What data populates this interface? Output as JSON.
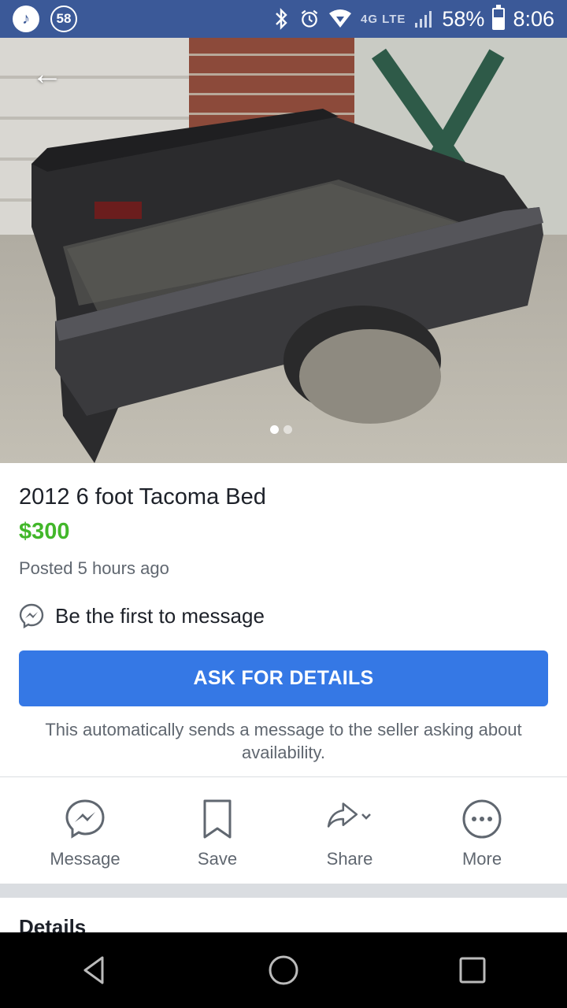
{
  "status_bar": {
    "notification_count": "58",
    "network": "4G LTE",
    "battery": "58%",
    "battery_level": 0.58,
    "time": "8:06"
  },
  "photo": {
    "pager": {
      "total": 2,
      "current": 1
    }
  },
  "listing": {
    "title": "2012 6 foot Tacoma Bed",
    "price": "$300",
    "posted": "Posted 5 hours ago",
    "first_message": "Be the first to message",
    "ask_button": "ASK FOR DETAILS",
    "ask_note": "This automatically sends a message to the seller asking about availability."
  },
  "actions": [
    {
      "label": "Message",
      "icon": "messenger-icon"
    },
    {
      "label": "Save",
      "icon": "bookmark-icon"
    },
    {
      "label": "Share",
      "icon": "share-icon"
    },
    {
      "label": "More",
      "icon": "more-icon"
    }
  ],
  "details": {
    "title": "Details"
  },
  "colors": {
    "status_bar": "#3b5998",
    "price": "#42b72a",
    "primary_button": "#3578e5",
    "secondary_text": "#606770"
  }
}
